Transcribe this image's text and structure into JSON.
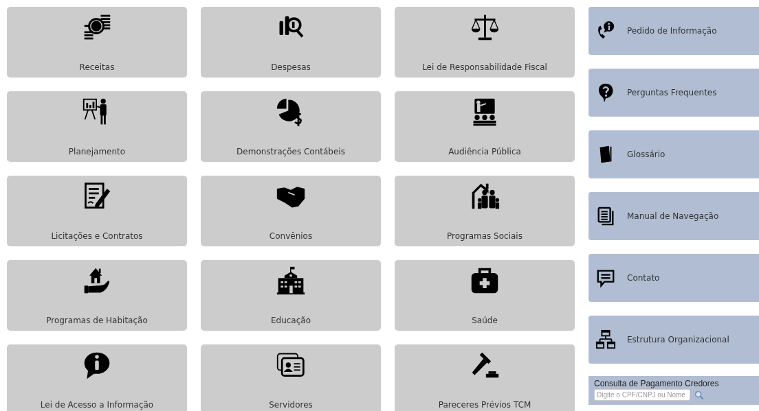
{
  "tiles": [
    {
      "label": "Receitas"
    },
    {
      "label": "Despesas"
    },
    {
      "label": "Lei de Responsabilidade Fiscal"
    },
    {
      "label": "Planejamento"
    },
    {
      "label": "Demonstrações Contábeis"
    },
    {
      "label": "Audiência Pública"
    },
    {
      "label": "Licitações e Contratos"
    },
    {
      "label": "Convênios"
    },
    {
      "label": "Programas Sociais"
    },
    {
      "label": "Programas de Habitação"
    },
    {
      "label": "Educação"
    },
    {
      "label": "Saúde"
    },
    {
      "label": "Lei de Acesso a Informação"
    },
    {
      "label": "Servidores"
    },
    {
      "label": "Pareceres Prévios TCM"
    }
  ],
  "side_links": [
    {
      "label": "Pedido de Informação"
    },
    {
      "label": "Perguntas Frequentes"
    },
    {
      "label": "Glossário"
    },
    {
      "label": "Manual de Navegação"
    },
    {
      "label": "Contato"
    },
    {
      "label": "Estrutura Organizacional"
    }
  ],
  "payment_search": {
    "title": "Consulta de Pagamento Credores",
    "placeholder": "Digite o CPF/CNPJ ou Nome"
  }
}
